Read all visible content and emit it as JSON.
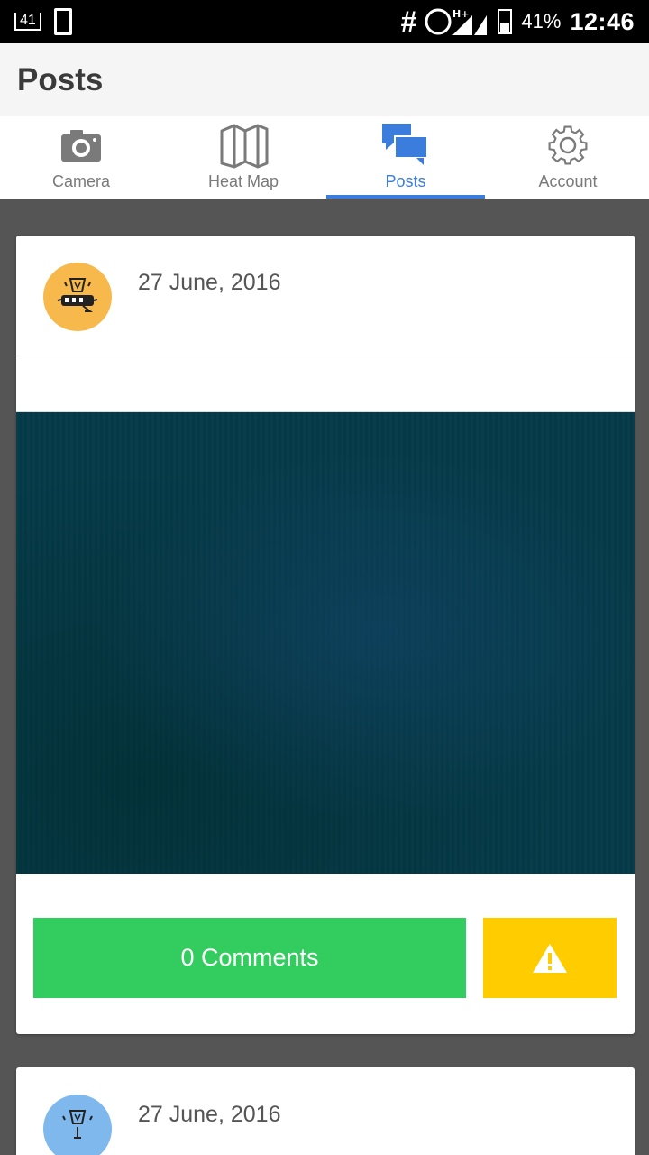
{
  "status_bar": {
    "notification_count": "41",
    "hash_symbol": "#",
    "network_type": "H+",
    "battery_percent": "41%",
    "time": "12:46"
  },
  "app_bar": {
    "title": "Posts"
  },
  "tabs": [
    {
      "label": "Camera",
      "icon": "camera-icon",
      "active": false
    },
    {
      "label": "Heat Map",
      "icon": "map-icon",
      "active": false
    },
    {
      "label": "Posts",
      "icon": "chat-bubbles-icon",
      "active": true
    },
    {
      "label": "Account",
      "icon": "gear-icon",
      "active": false
    }
  ],
  "posts": [
    {
      "date": "27 June, 2016",
      "avatar_color": "#f7b94c",
      "comments_label": "0 Comments",
      "report_icon": "warning-icon"
    },
    {
      "date": "27 June, 2016",
      "avatar_color": "#7fb8ec"
    }
  ],
  "colors": {
    "accent": "#3b7ddd",
    "comments_button": "#33cc5f",
    "report_button": "#ffcc00",
    "background": "#555555"
  }
}
